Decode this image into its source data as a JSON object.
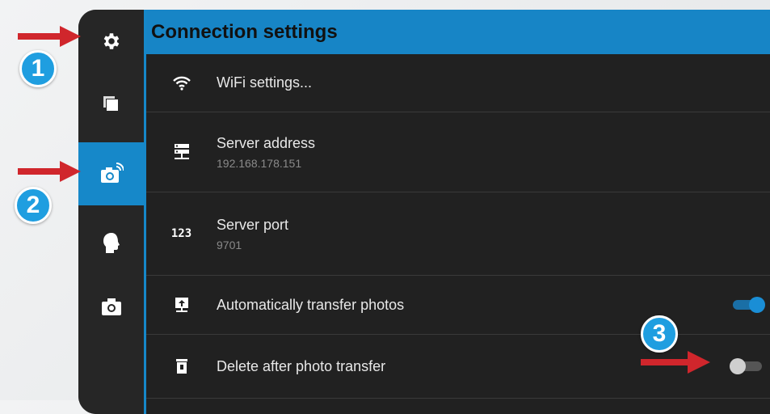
{
  "header": {
    "title": "Connection settings"
  },
  "sidebar": {
    "items": [
      {
        "icon": "gear-icon",
        "active": false
      },
      {
        "icon": "copy-icon",
        "active": false
      },
      {
        "icon": "remote-camera-icon",
        "active": true
      },
      {
        "icon": "head-silhouette-icon",
        "active": false
      },
      {
        "icon": "camera-icon",
        "active": false
      }
    ]
  },
  "settings": {
    "wifi": {
      "title": "WiFi settings...",
      "icon": "wifi-icon"
    },
    "server_address": {
      "title": "Server address",
      "value": "192.168.178.151",
      "icon": "server-icon"
    },
    "server_port": {
      "title": "Server port",
      "value": "9701",
      "icon_text": "123"
    },
    "auto_transfer": {
      "title": "Automatically transfer photos",
      "enabled": true,
      "icon": "upload-monitor-icon"
    },
    "delete_after": {
      "title": "Delete after photo transfer",
      "enabled": false,
      "icon": "trash-icon"
    }
  },
  "annotations": {
    "badges": [
      "1",
      "2",
      "3"
    ],
    "colors": {
      "arrow": "#d0262c",
      "badge": "#1f9ee0",
      "accent": "#1688c9"
    }
  }
}
